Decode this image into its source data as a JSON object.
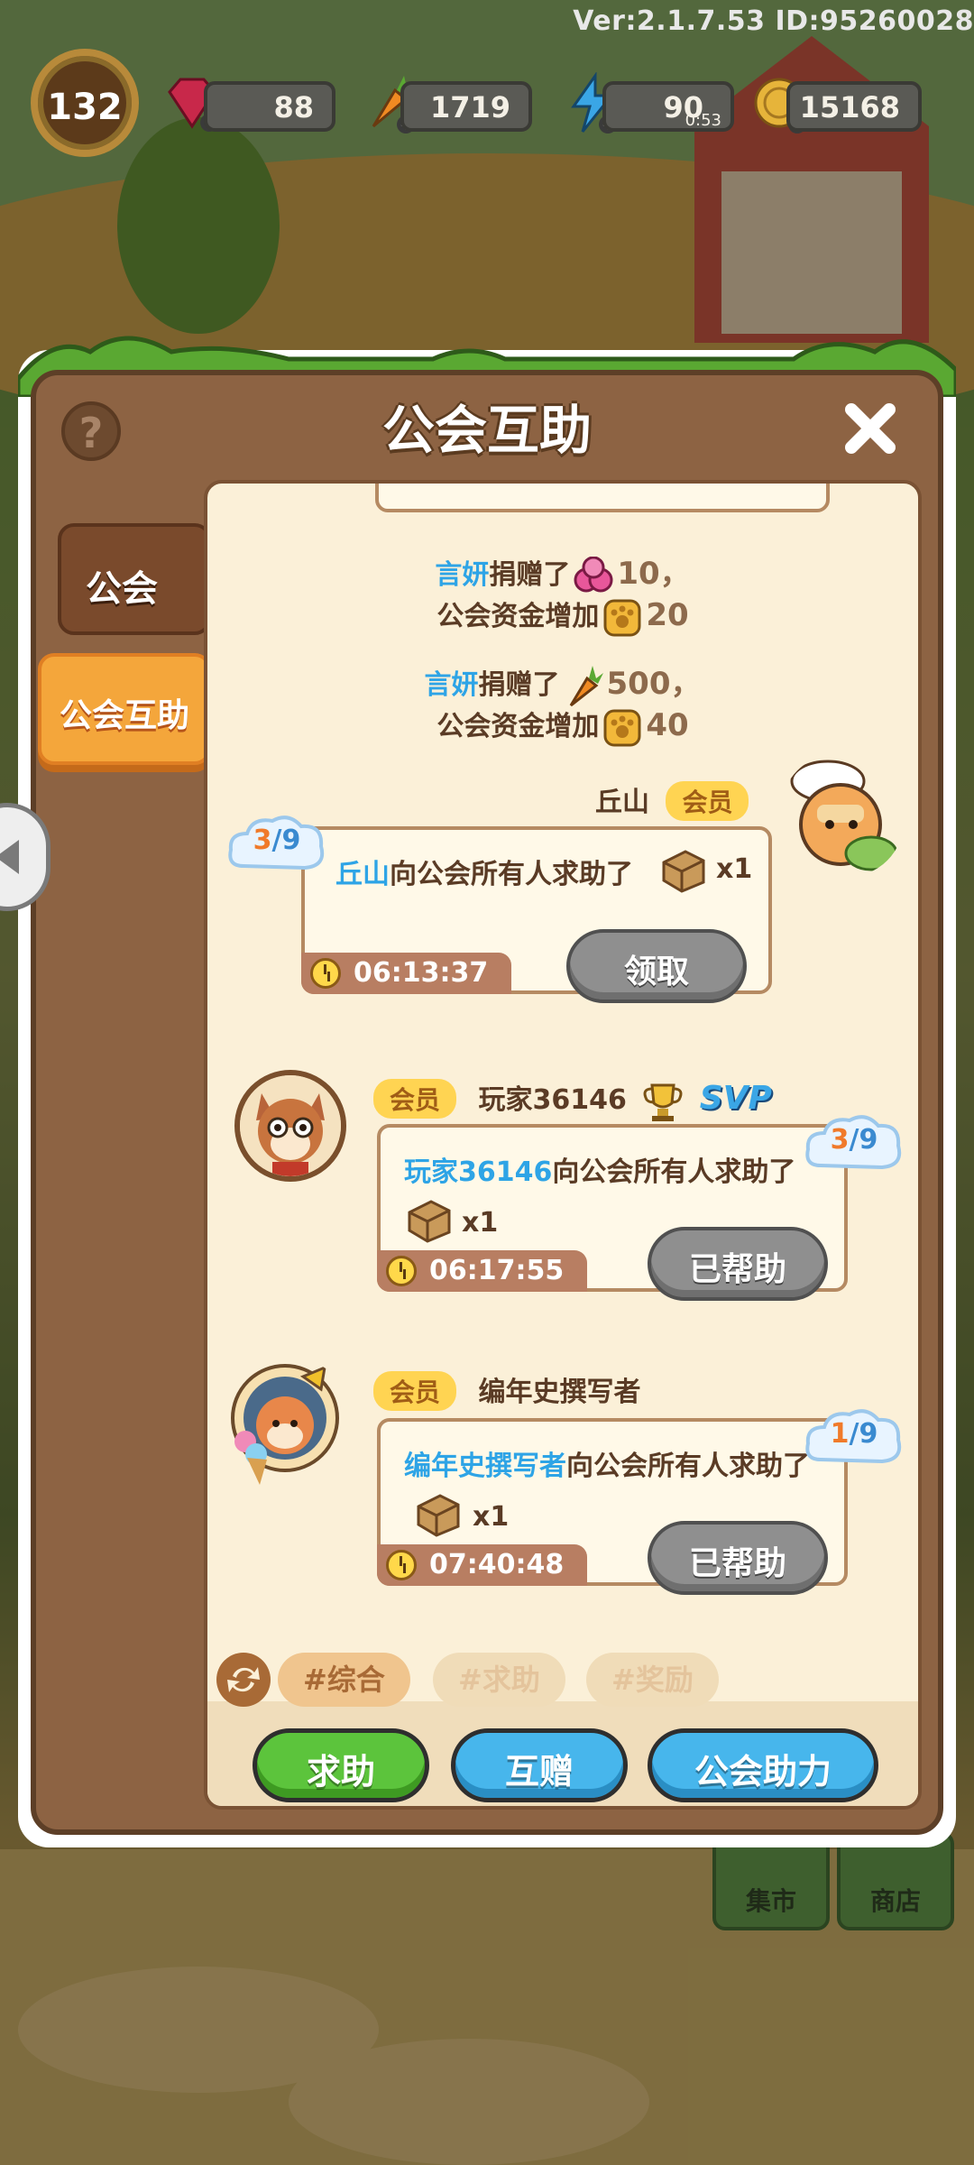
{
  "version_label": "Ver:2.1.7.53 ID:95260028",
  "hud": {
    "level": "132",
    "gems": "88",
    "carrots": "1719",
    "energy": "90",
    "energy_timer": "0:53",
    "coins": "15168"
  },
  "panel": {
    "title": "公会互助",
    "help_symbol": "?"
  },
  "side_tabs": [
    {
      "label": "公会"
    },
    {
      "label": "公会互助"
    }
  ],
  "donations": [
    {
      "name": "言妍",
      "action": "捐赠了",
      "amount": "10，",
      "fund_text": "公会资金增加",
      "fund_amount": "20",
      "item_icon": "gem-icon"
    },
    {
      "name": "言妍",
      "action": "捐赠了",
      "amount": "500，",
      "fund_text": "公会资金增加",
      "fund_amount": "40",
      "item_icon": "carrot-icon"
    }
  ],
  "requests": [
    {
      "sender": "丘山",
      "role": "会员",
      "name_in_text": "丘山",
      "text": "向公会所有人求助了",
      "qty": "x1",
      "time": "06:13:37",
      "button": "领取",
      "progress": "3/9",
      "progress_num": "3",
      "progress_den": "/9"
    },
    {
      "sender": "玩家36146",
      "role": "会员",
      "badge": "SVP",
      "name_in_text": "玩家36146",
      "text": "向公会所有人求助了",
      "qty": "x1",
      "time": "06:17:55",
      "button": "已帮助",
      "progress": "3/9",
      "progress_num": "3",
      "progress_den": "/9"
    },
    {
      "sender": "编年史撰写者",
      "role": "会员",
      "name_in_text": "编年史撰写者",
      "text": "向公会所有人求助了",
      "qty": "x1",
      "time": "07:40:48",
      "button": "已帮助",
      "progress": "1/9",
      "progress_num": "1",
      "progress_den": "/9"
    }
  ],
  "filter_tags": [
    "#综合",
    "#求助",
    "#奖励"
  ],
  "actions": [
    "求助",
    "互赠",
    "公会助力"
  ],
  "background_buttons": [
    "集市",
    "商店"
  ],
  "colors": {
    "panel_brown": "#8d6343",
    "chat_bg": "#fbf0d8",
    "name_blue": "#2ea4e6",
    "member_badge": "#ffd452",
    "tab_active": "#f4a63b",
    "btn_green": "#5cc43c",
    "btn_blue": "#47b6ec"
  }
}
